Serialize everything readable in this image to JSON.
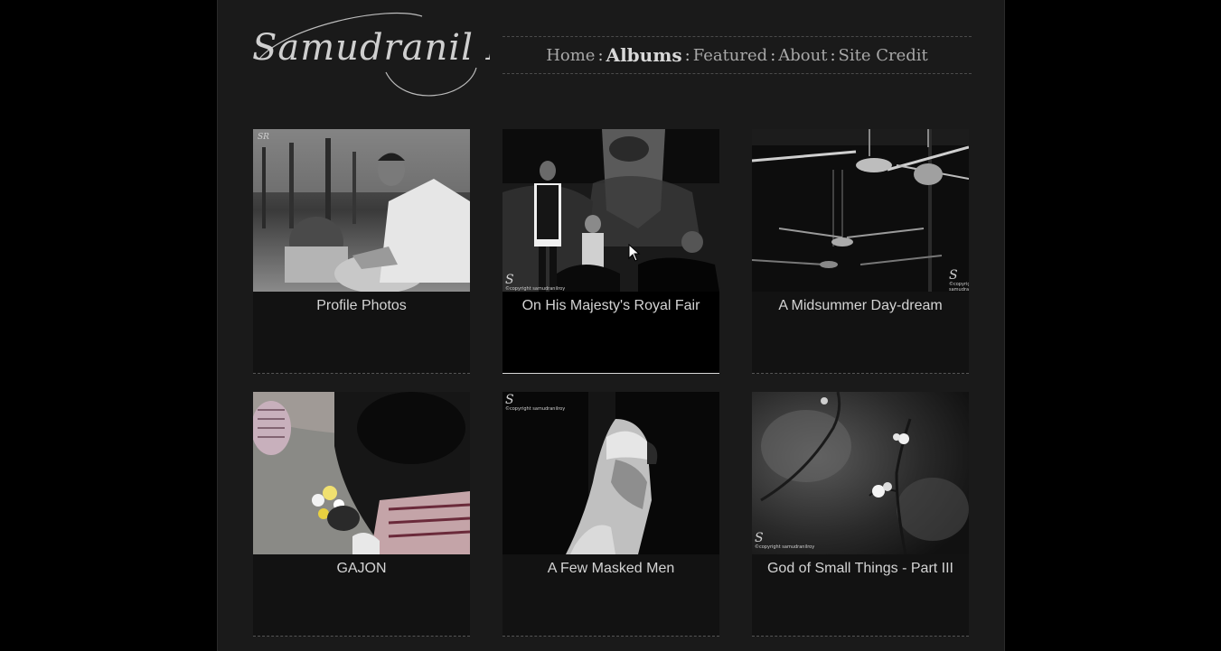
{
  "site": {
    "logo_text": "Samudranil Roy"
  },
  "nav": {
    "items": [
      {
        "label": "Home"
      },
      {
        "label": "Albums"
      },
      {
        "label": "Featured"
      },
      {
        "label": "About"
      },
      {
        "label": "Site Credit"
      }
    ],
    "separator": ":",
    "active": "Albums"
  },
  "albums": [
    {
      "title": "Profile Photos"
    },
    {
      "title": "On His Majesty's Royal Fair"
    },
    {
      "title": "A Midsummer Day-dream"
    },
    {
      "title": "GAJON"
    },
    {
      "title": "A Few Masked Men"
    },
    {
      "title": "God of Small Things - Part III"
    }
  ],
  "watermark": {
    "letter": "S",
    "caption": "©copyright samudranilroy",
    "initials": "SR"
  },
  "colors": {
    "background": "#000000",
    "panel": "#1a1a1a",
    "card": "#121212",
    "text": "#d4d4d4",
    "nav_text": "#a8a8a8"
  }
}
